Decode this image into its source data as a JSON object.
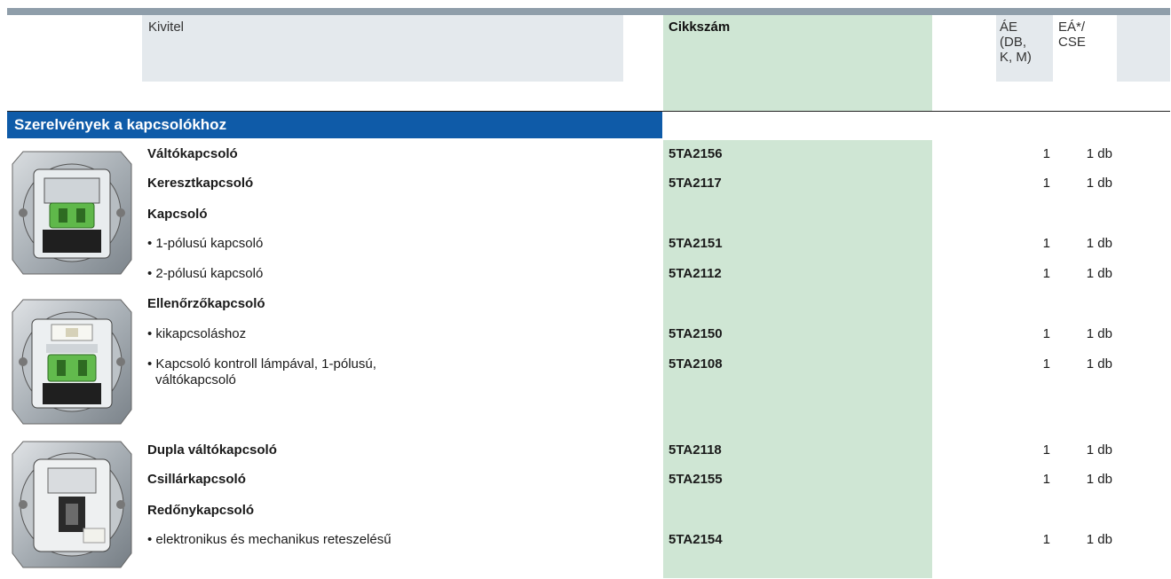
{
  "header": {
    "kivitel": "Kivitel",
    "cikkszam": "Cikkszám",
    "ae_lines": [
      "ÁE",
      "(DB,",
      "K, M)"
    ],
    "ea_lines": [
      "EÁ*/",
      "CSE"
    ]
  },
  "section": {
    "title": "Szerelvények a kapcsolókhoz"
  },
  "rows": [
    {
      "label": "Váltókapcsoló",
      "bold": true,
      "article": "5TA2156",
      "qty": "1",
      "unit": "1 db"
    },
    {
      "label": "Keresztkapcsoló",
      "bold": true,
      "article": "5TA2117",
      "qty": "1",
      "unit": "1 db"
    },
    {
      "label": "Kapcsoló",
      "bold": true,
      "article": "",
      "qty": "",
      "unit": ""
    },
    {
      "label": "• 1-pólusú kapcsoló",
      "bold": false,
      "article": "5TA2151",
      "qty": "1",
      "unit": "1 db"
    },
    {
      "label": "• 2-pólusú kapcsoló",
      "bold": false,
      "article": "5TA2112",
      "qty": "1",
      "unit": "1 db"
    },
    {
      "label": "Ellenőrzőkapcsoló",
      "bold": true,
      "article": "",
      "qty": "",
      "unit": ""
    },
    {
      "label": "• kikapcsoláshoz",
      "bold": false,
      "article": "5TA2150",
      "qty": "1",
      "unit": "1 db"
    },
    {
      "label": "• Kapcsoló kontroll lámpával, 1-pólusú,",
      "label2": "váltókapcsoló",
      "bold": false,
      "article": "5TA2108",
      "qty": "1",
      "unit": "1 db"
    },
    {
      "label": "Dupla váltókapcsoló",
      "bold": true,
      "article": "5TA2118",
      "qty": "1",
      "unit": "1 db"
    },
    {
      "label": "Csillárkapcsoló",
      "bold": true,
      "article": "5TA2155",
      "qty": "1",
      "unit": "1 db"
    },
    {
      "label": "Redőnykapcsoló",
      "bold": true,
      "article": "",
      "qty": "",
      "unit": ""
    },
    {
      "label": "• elektronikus és mechanikus reteszelésű",
      "bold": false,
      "article": "5TA2154",
      "qty": "1",
      "unit": "1 db"
    }
  ],
  "images": [
    "switch-insert-green-icon",
    "control-switch-insert-icon",
    "double-switch-insert-icon"
  ]
}
